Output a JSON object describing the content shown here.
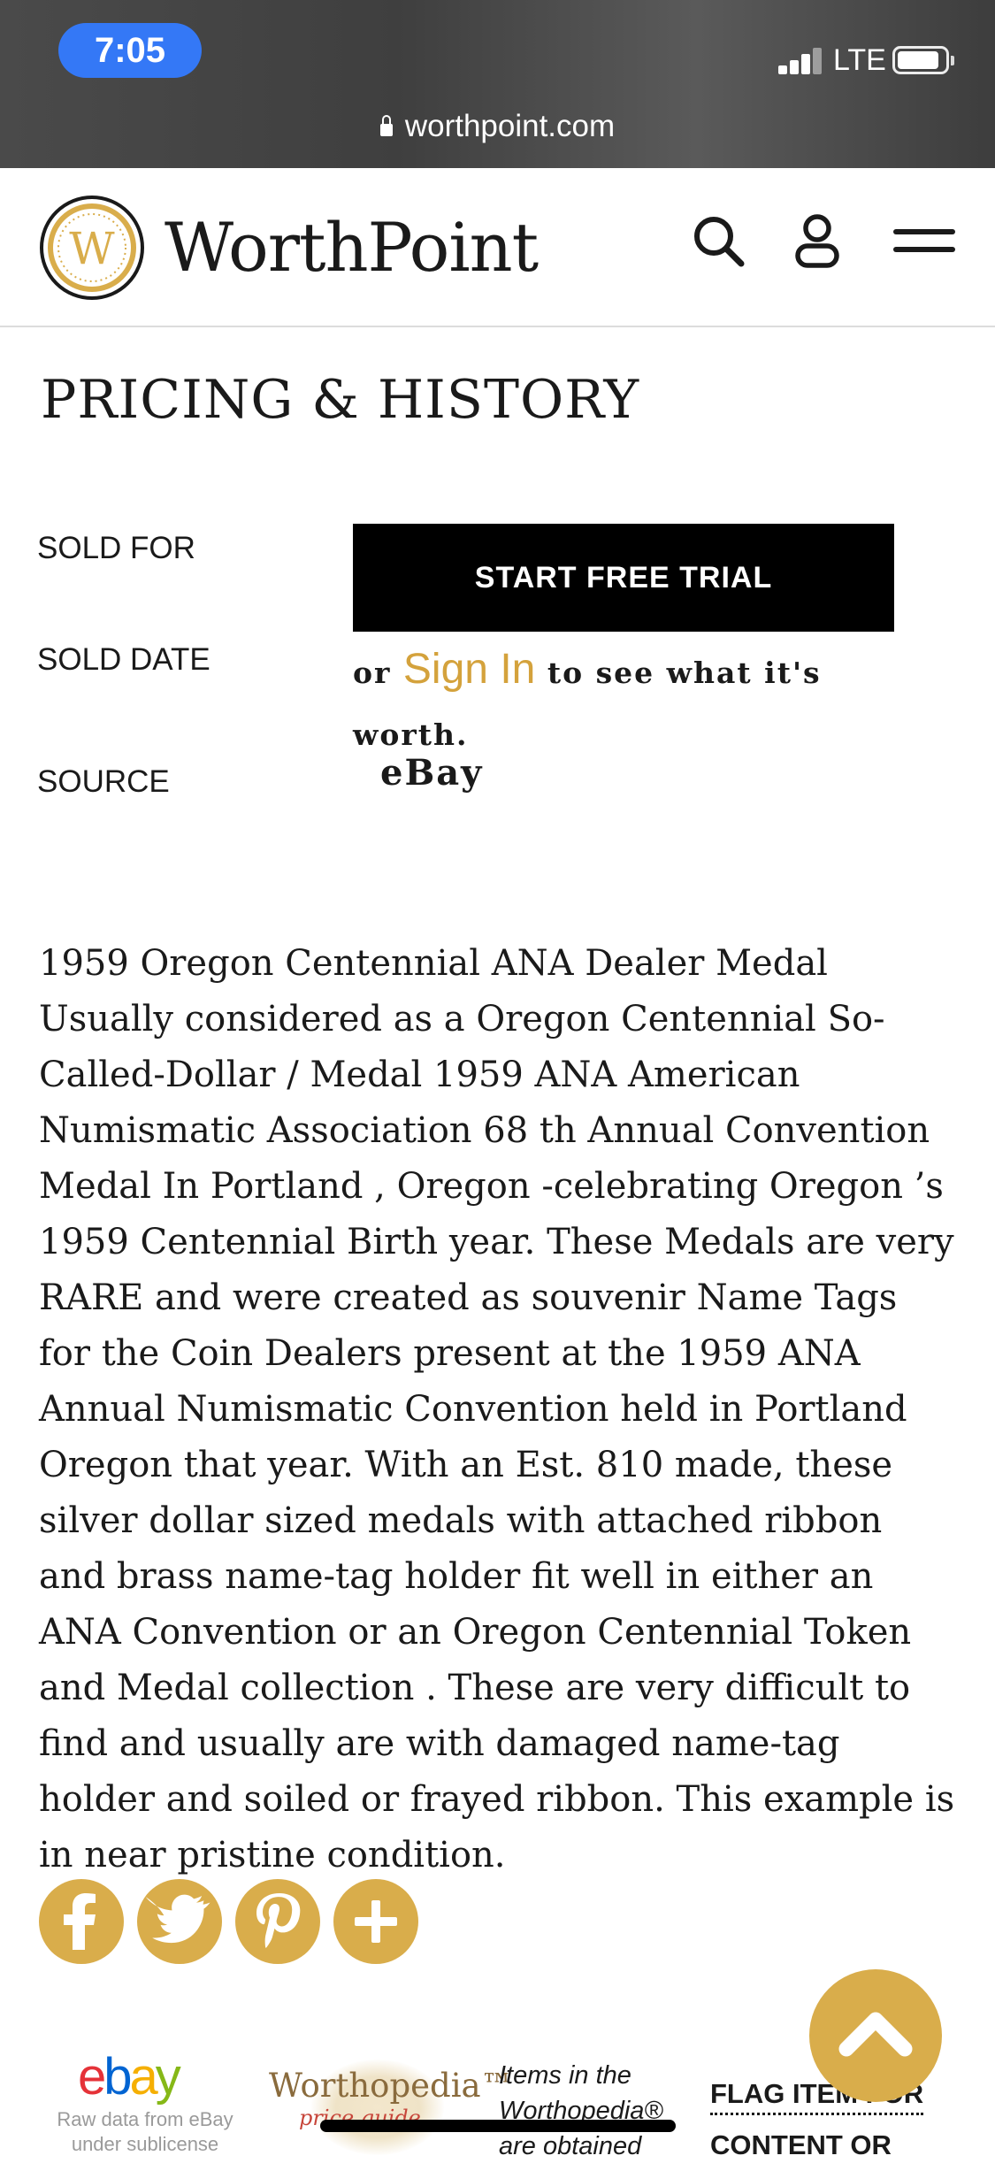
{
  "status_bar": {
    "time": "7:05",
    "network": "LTE"
  },
  "browser": {
    "url": "worthpoint.com"
  },
  "header": {
    "logo_letter": "W",
    "logo_text": "WorthPoint",
    "icons": [
      "search-icon",
      "account-icon",
      "menu-icon"
    ]
  },
  "pricing": {
    "title": "PRICING & HISTORY",
    "labels": {
      "sold_for": "SOLD FOR",
      "sold_date": "SOLD DATE",
      "source": "SOURCE"
    },
    "trial_button": "START FREE TRIAL",
    "signin_prefix": "or",
    "signin_link": "Sign In",
    "signin_suffix": "to see what it's worth.",
    "source_value": "eBay"
  },
  "description": "1959 Oregon Centennial ANA Dealer Medal Usually considered as a Oregon Centennial So-Called-Dollar / Medal 1959 ANA American Numismatic Association 68 th Annual Convention Medal In Portland , Oregon -celebrating Oregon ’s 1959 Centennial Birth year. These Medals are very RARE and were created as souvenir Name Tags for the Coin Dealers present at the 1959 ANA Annual Numismatic Convention held in Portland Oregon that year. With an Est. 810 made, these silver dollar sized medals with attached ribbon and brass name-tag holder fit well in either an ANA Convention or an Oregon Centennial Token and Medal collection . These are very difficult to find and usually are with damaged name-tag holder and soiled or frayed ribbon. This example is in near pristine condition.",
  "share": {
    "buttons": [
      "facebook-icon",
      "twitter-icon",
      "pinterest-icon",
      "plus-icon"
    ]
  },
  "footer": {
    "ebay_letters": [
      "e",
      "b",
      "a",
      "y"
    ],
    "ebay_caption": "Raw data from eBay under sublicense",
    "worthopedia_name": "Worthopedia™",
    "worthopedia_sub": "price guide",
    "items_text": "Items in the Worthopedia® are obtained",
    "flag_line1": "FLAG ITEM FOR",
    "flag_line2": "CONTENT OR"
  },
  "colors": {
    "accent_gold": "#d9ad4b",
    "signin_gold": "#d4a23c",
    "status_pill_blue": "#3478f6"
  }
}
